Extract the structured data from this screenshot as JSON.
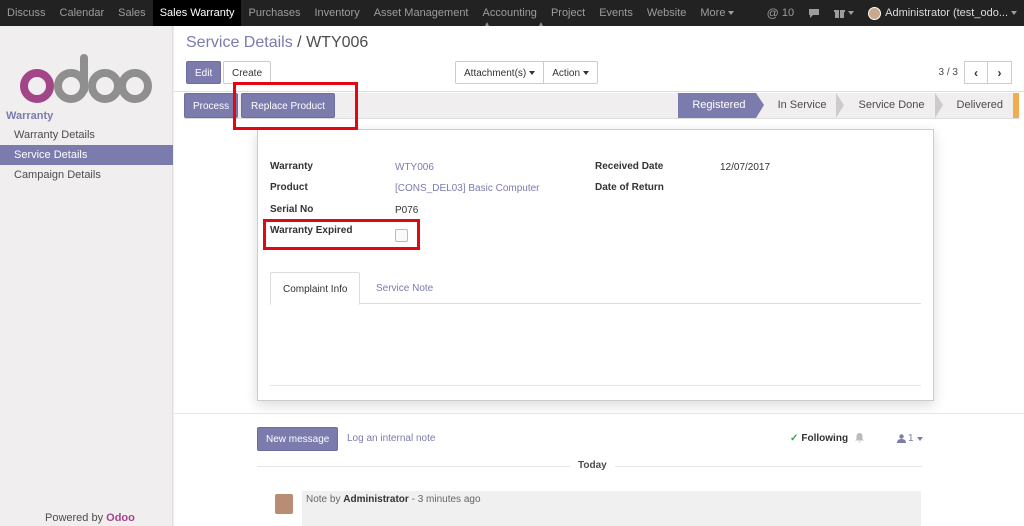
{
  "topnav": {
    "menu": [
      "Discuss",
      "Calendar",
      "Sales",
      "Sales Warranty",
      "Purchases",
      "Inventory",
      "Asset Management",
      "Accounting",
      "Project",
      "Events",
      "Website",
      "More"
    ],
    "active_index": 3,
    "messages_count": "10",
    "user": "Administrator (test_odo..."
  },
  "sidebar": {
    "logo_text": "odoo",
    "section": "Warranty",
    "items": [
      "Warranty Details",
      "Service Details",
      "Campaign Details"
    ],
    "active_index": 1,
    "powered_by_prefix": "Powered by",
    "powered_by_brand": "Odoo"
  },
  "control_panel": {
    "breadcrumb_parent": "Service Details",
    "breadcrumb_separator": "/",
    "breadcrumb_current": "WTY006",
    "edit_label": "Edit",
    "create_label": "Create",
    "attachments_label": "Attachment(s)",
    "action_label": "Action",
    "pager_value": "3 / 3"
  },
  "statusbar": {
    "process_label": "Process",
    "replace_label": "Replace Product",
    "stages": [
      "Registered",
      "In Service",
      "Service Done",
      "Delivered"
    ],
    "active_stage": "Registered"
  },
  "form": {
    "warranty_label": "Warranty",
    "warranty_value": "WTY006",
    "product_label": "Product",
    "product_value": "[CONS_DEL03] Basic Computer",
    "serial_label": "Serial No",
    "serial_value": "P076",
    "expired_label": "Warranty Expired",
    "expired_checked": false,
    "received_label": "Received Date",
    "received_value": "12/07/2017",
    "return_label": "Date of Return",
    "return_value": "",
    "tabs": [
      "Complaint Info",
      "Service Note"
    ]
  },
  "chatter": {
    "new_message_label": "New message",
    "log_note_label": "Log an internal note",
    "following_label": "Following",
    "followers_count": "1",
    "day_separator": "Today",
    "message_prefix": "Note by",
    "message_author": "Administrator",
    "message_time": "- 3 minutes ago"
  },
  "colors": {
    "brand": "#7c7bad",
    "highlight": "#e30613",
    "topbar": "#222222"
  }
}
